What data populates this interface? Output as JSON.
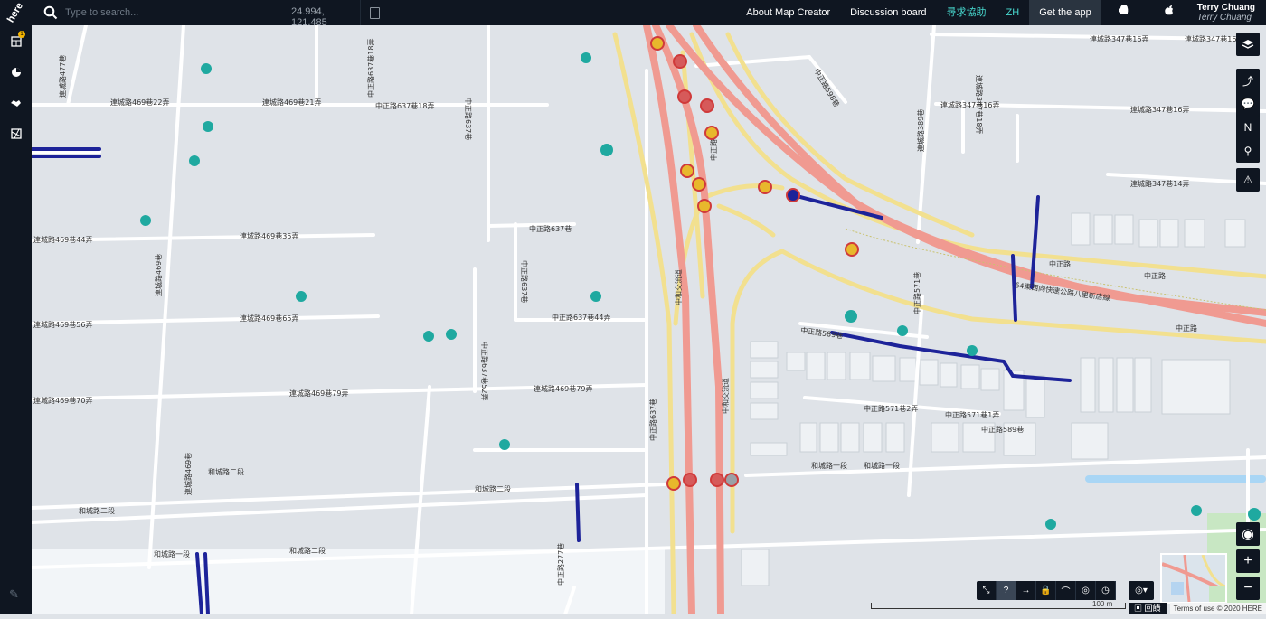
{
  "app": {
    "logo": "here"
  },
  "search": {
    "placeholder": "Type to search...",
    "coords": "24.994, 121.485"
  },
  "nav": {
    "about": "About Map Creator",
    "discussion": "Discussion board",
    "help": "尋求協助",
    "lang": "ZH",
    "get_app": "Get the app",
    "user_name": "Terry Chuang",
    "user_sub": "Terry Chuang"
  },
  "sidebar": {
    "badge": "1"
  },
  "map": {
    "labels": {
      "l1": "中正路637巷18弄",
      "l2": "中正路637巷18弄",
      "l3": "中正路637巷",
      "l4": "連城路469巷22弄",
      "l5": "連城路469巷21弄",
      "l6": "連城路477巷",
      "l7": "連城路469巷35弄",
      "l8": "連城路469巷44弄",
      "l9": "中正路637巷",
      "l10": "中正路637巷44弄",
      "l11": "連城路469巷56弄",
      "l12": "連城路469巷65弄",
      "l13": "連城路469巷70弄",
      "l14": "連城路469巷79弄",
      "l15": "連城路469巷79弄",
      "l16": "中正路637巷52弄",
      "l17": "中正路637巷",
      "l18": "和城路二段",
      "l19": "和城路一段",
      "l20": "和城路一段",
      "l21": "和城路二段",
      "l22": "中正路598巷",
      "l23": "連城路347巷16弄",
      "l24": "連城路347巷18弄",
      "l25": "連城路347巷16弄",
      "l26": "連城路347巷16弄",
      "l27": "連城路347巷16弄",
      "l28": "連城路389巷",
      "l29": "連城路347巷14弄",
      "l30": "中正路",
      "l31": "中正路",
      "l32": "64東西向快速公路八里新店線",
      "l33": "中正路589巷",
      "l34": "中正路571巷",
      "l35": "中正路571巷2弄",
      "l36": "中正路571巷1弄",
      "l37": "中和交流道",
      "l38": "中和交流道",
      "l39": "中正路637巷",
      "l40": "中正路",
      "l41": "和城路二段",
      "l42": "中正路",
      "l43": "和城路一段",
      "l44": "中正路277巷",
      "l45": "和城路二段",
      "l46": "連城路469巷",
      "l47": "中正路589巷",
      "l48": "連城路469巷"
    }
  },
  "controls": {
    "scale_label": "100 m",
    "feedback": "回饋",
    "terms": "Terms of use © 2020 HERE"
  }
}
